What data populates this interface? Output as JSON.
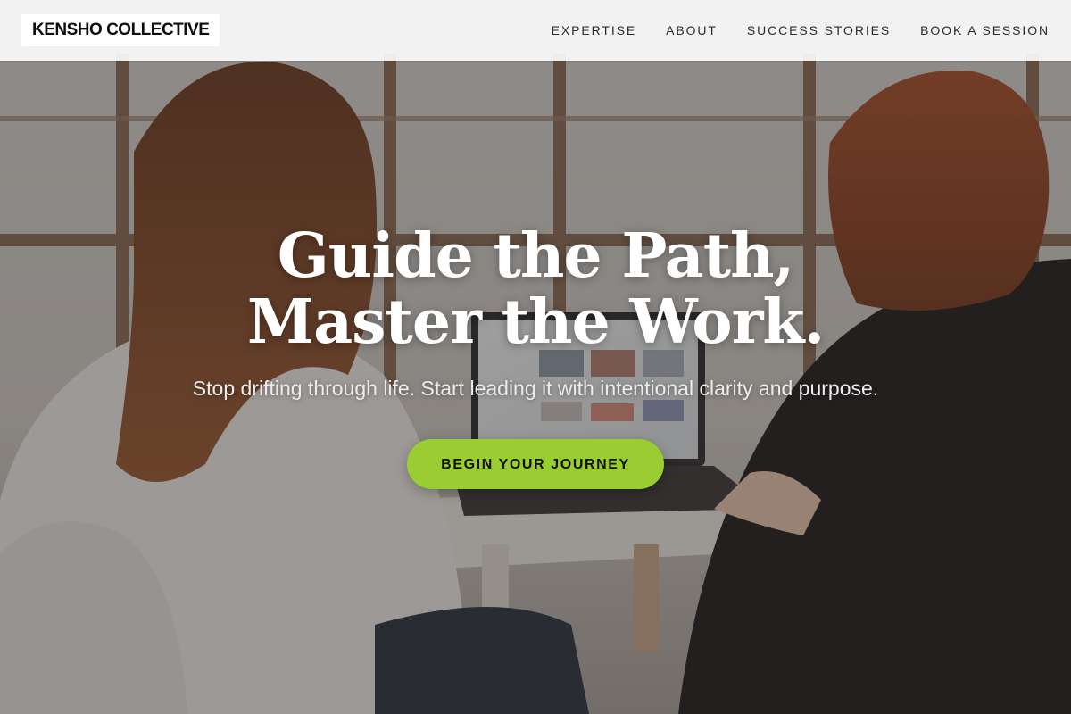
{
  "header": {
    "logo_text": "KENSHO COLLECTIVE",
    "nav": [
      {
        "label": "EXPERTISE"
      },
      {
        "label": "ABOUT"
      },
      {
        "label": "SUCCESS STORIES"
      },
      {
        "label": "BOOK A SESSION"
      }
    ]
  },
  "hero": {
    "title": "Guide the Path, Master the Work.",
    "subtitle": "Stop drifting through life. Start leading it with intentional clarity and purpose.",
    "cta_label": "BEGIN YOUR JOURNEY",
    "background_image": "photo of two women with long red hair seen from behind, working at a laptop on a white table in front of a large window"
  },
  "colors": {
    "accent": "#9acd32",
    "header_bg": "#fafafa",
    "nav_text": "#2b2b2b",
    "hero_text": "#ffffff"
  }
}
